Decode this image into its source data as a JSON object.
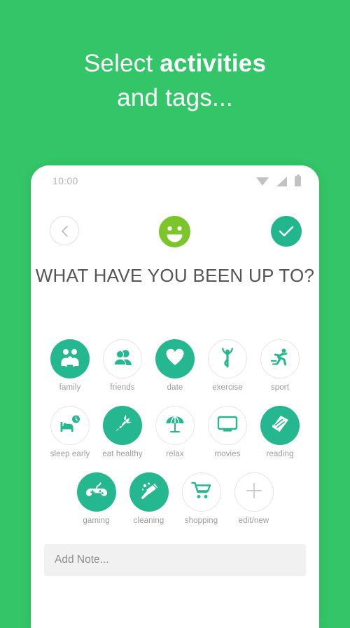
{
  "colors": {
    "background_green": "#33c567",
    "accent_teal": "#25b890",
    "face_green": "#7cc62c",
    "label_gray": "#9c9c9c",
    "question_gray": "#555555"
  },
  "headline": {
    "line1_prefix": "Select ",
    "line1_strong": "activities",
    "line2": "and tags..."
  },
  "phone": {
    "statusbar": {
      "time": "10:00",
      "icons": [
        "wifi-icon",
        "signal-icon",
        "battery-icon"
      ]
    },
    "nav": {
      "back_label": "back-chevron-icon",
      "mood_label": "happy-face-icon",
      "confirm_label": "check-icon"
    },
    "question": "WHAT HAVE YOU BEEN UP TO?",
    "activities": [
      [
        {
          "label": "family",
          "icon": "family-icon",
          "selected": true
        },
        {
          "label": "friends",
          "icon": "friends-icon",
          "selected": false
        },
        {
          "label": "date",
          "icon": "heart-icon",
          "selected": true
        },
        {
          "label": "exercise",
          "icon": "yoga-icon",
          "selected": false
        },
        {
          "label": "sport",
          "icon": "running-icon",
          "selected": false
        }
      ],
      [
        {
          "label": "sleep early",
          "icon": "bed-clock-icon",
          "selected": false
        },
        {
          "label": "eat healthy",
          "icon": "carrot-icon",
          "selected": true
        },
        {
          "label": "relax",
          "icon": "parasol-icon",
          "selected": false
        },
        {
          "label": "movies",
          "icon": "tv-icon",
          "selected": false
        },
        {
          "label": "reading",
          "icon": "book-icon",
          "selected": true
        }
      ],
      [
        {
          "label": "gaming",
          "icon": "gamepad-icon",
          "selected": true
        },
        {
          "label": "cleaning",
          "icon": "broom-icon",
          "selected": true
        },
        {
          "label": "shopping",
          "icon": "cart-icon",
          "selected": false
        },
        {
          "label": "edit/new",
          "icon": "plus-icon",
          "selected": false
        }
      ]
    ],
    "note": {
      "value": "",
      "placeholder": "Add Note..."
    }
  }
}
